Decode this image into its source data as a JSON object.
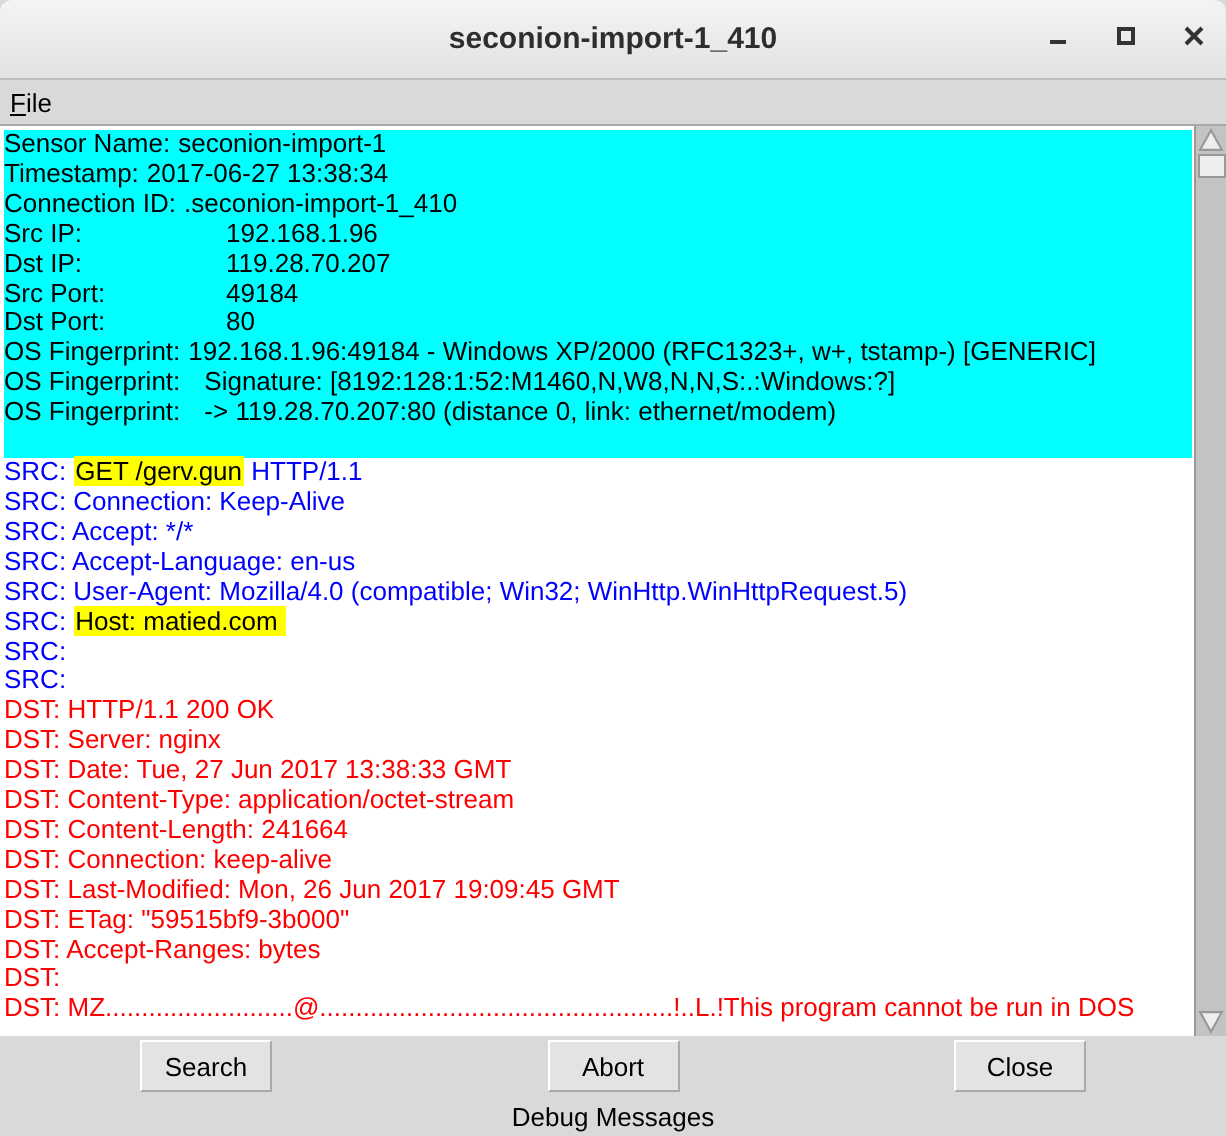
{
  "window": {
    "title": "seconion-import-1_410"
  },
  "menu": [
    "File"
  ],
  "header": [
    {
      "kind": "inline",
      "label": "Sensor Name:",
      "value": "seconion-import-1"
    },
    {
      "kind": "inline",
      "label": "Timestamp:",
      "value": "2017-06-27 13:38:34"
    },
    {
      "kind": "inline",
      "label": "Connection ID:",
      "value": ".seconion-import-1_410"
    },
    {
      "kind": "aligned",
      "label": "Src IP:",
      "value": "192.168.1.96"
    },
    {
      "kind": "aligned",
      "label": "Dst IP:",
      "value": "119.28.70.207"
    },
    {
      "kind": "aligned",
      "label": "Src Port:",
      "value": "49184"
    },
    {
      "kind": "aligned",
      "label": "Dst Port:",
      "value": "80"
    },
    {
      "kind": "inline",
      "label": "OS Fingerprint:",
      "value": "192.168.1.96:49184 - Windows XP/2000 (RFC1323+, w+, tstamp-) [GENERIC]"
    },
    {
      "kind": "indented",
      "label": "OS Fingerprint:",
      "value": "Signature: [8192:128:1:52:M1460,N,W8,N,N,S:.:Windows:?]"
    },
    {
      "kind": "indented",
      "label": "OS Fingerprint:",
      "value": "-> 119.28.70.207:80 (distance 0, link: ethernet/modem)"
    }
  ],
  "transcript": [
    {
      "kind": "src",
      "segments": [
        {
          "text": "SRC: ",
          "highlighted": false
        },
        {
          "text": "GET /gerv.gun",
          "highlighted": true
        },
        {
          "text": " HTTP/1.1",
          "highlighted": false
        }
      ]
    },
    {
      "kind": "src",
      "segments": [
        {
          "text": "SRC: Connection: Keep-Alive",
          "highlighted": false
        }
      ]
    },
    {
      "kind": "src",
      "segments": [
        {
          "text": "SRC: Accept: */*",
          "highlighted": false
        }
      ]
    },
    {
      "kind": "src",
      "segments": [
        {
          "text": "SRC: Accept-Language: en-us",
          "highlighted": false
        }
      ]
    },
    {
      "kind": "src",
      "segments": [
        {
          "text": "SRC: User-Agent: Mozilla/4.0 (compatible; Win32; WinHttp.WinHttpRequest.5)",
          "highlighted": false
        }
      ]
    },
    {
      "kind": "src",
      "segments": [
        {
          "text": "SRC: ",
          "highlighted": false
        },
        {
          "text": "Host: matied.com ",
          "highlighted": true
        }
      ]
    },
    {
      "kind": "src",
      "segments": [
        {
          "text": "SRC:",
          "highlighted": false
        }
      ]
    },
    {
      "kind": "src",
      "segments": [
        {
          "text": "SRC:",
          "highlighted": false
        }
      ]
    },
    {
      "kind": "dst",
      "segments": [
        {
          "text": "DST: HTTP/1.1 200 OK",
          "highlighted": false
        }
      ]
    },
    {
      "kind": "dst",
      "segments": [
        {
          "text": "DST: Server: nginx",
          "highlighted": false
        }
      ]
    },
    {
      "kind": "dst",
      "segments": [
        {
          "text": "DST: Date: Tue, 27 Jun 2017 13:38:33 GMT",
          "highlighted": false
        }
      ]
    },
    {
      "kind": "dst",
      "segments": [
        {
          "text": "DST: Content-Type: application/octet-stream",
          "highlighted": false
        }
      ]
    },
    {
      "kind": "dst",
      "segments": [
        {
          "text": "DST: Content-Length: 241664",
          "highlighted": false
        }
      ]
    },
    {
      "kind": "dst",
      "segments": [
        {
          "text": "DST: Connection: keep-alive",
          "highlighted": false
        }
      ]
    },
    {
      "kind": "dst",
      "segments": [
        {
          "text": "DST: Last-Modified: Mon, 26 Jun 2017 19:09:45 GMT",
          "highlighted": false
        }
      ]
    },
    {
      "kind": "dst",
      "segments": [
        {
          "text": "DST: ETag: \"59515bf9-3b000\"",
          "highlighted": false
        }
      ]
    },
    {
      "kind": "dst",
      "segments": [
        {
          "text": "DST: Accept-Ranges: bytes",
          "highlighted": false
        }
      ]
    },
    {
      "kind": "dst",
      "segments": [
        {
          "text": "DST:",
          "highlighted": false
        }
      ]
    },
    {
      "kind": "dst",
      "segments": [
        {
          "text": "DST: MZ..........................@.................................................!..L.!This program cannot be run in DOS",
          "highlighted": false
        }
      ]
    }
  ],
  "buttons": [
    "Search",
    "Abort",
    "Close"
  ],
  "status_bar": "Debug Messages"
}
